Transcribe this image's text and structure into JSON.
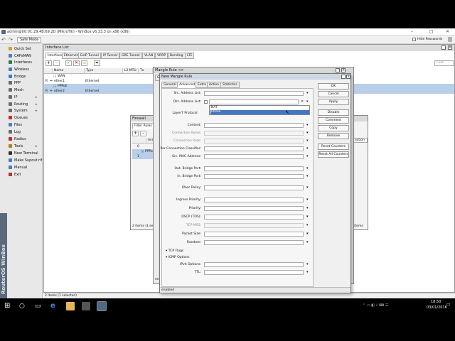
{
  "window": {
    "title": "admin@00:0C:29:4B:69:2D (MikroTik) - WinBox v6.33.3 on x86 (x86)",
    "controls": [
      "–",
      "□",
      "✕"
    ]
  },
  "toolbar": {
    "safe_mode": "Safe Mode",
    "hide_passwords": "Hide Passwords"
  },
  "sidebar": {
    "brand": "RouterOS WinBox",
    "items": [
      {
        "label": "Quick Set",
        "color": "#d9a020"
      },
      {
        "label": "CAPsMAN",
        "color": "#4a7cc0"
      },
      {
        "label": "Interfaces",
        "color": "#2e7d32"
      },
      {
        "label": "Wireless",
        "color": "#4a7cc0"
      },
      {
        "label": "Bridge",
        "color": "#3a7bd5"
      },
      {
        "label": "PPP",
        "color": "#6a6a6a"
      },
      {
        "label": "Mesh",
        "color": "#6a6a6a"
      },
      {
        "label": "IP",
        "color": "#6a6a6a"
      },
      {
        "label": "Routing",
        "color": "#6a6a6a"
      },
      {
        "label": "System",
        "color": "#6a6a6a"
      },
      {
        "label": "Queues",
        "color": "#c62828"
      },
      {
        "label": "Files",
        "color": "#4a7cc0"
      },
      {
        "label": "Log",
        "color": "#6a6a6a"
      },
      {
        "label": "Radius",
        "color": "#c62828"
      },
      {
        "label": "Tools",
        "color": "#b08020"
      },
      {
        "label": "New Terminal",
        "color": "#333333"
      },
      {
        "label": "Make Supout.rif",
        "color": "#4a7cc0"
      },
      {
        "label": "Manual",
        "color": "#4a7cc0"
      },
      {
        "label": "Exit",
        "color": "#c62828"
      }
    ]
  },
  "interface_list": {
    "title": "Interface List",
    "tabs": [
      "Interface",
      "Ethernet",
      "EoIP Tunnel",
      "IP Tunnel",
      "GRE Tunnel",
      "VLAN",
      "VRRP",
      "Bonding",
      "LTE"
    ],
    "find_placeholder": "Find",
    "columns": [
      "Name",
      "Type",
      "L2 MTU",
      "Tx"
    ],
    "rows": [
      {
        "flag": "",
        "name": ";;; WAN",
        "type": ""
      },
      {
        "flag": "R",
        "name": "ether1",
        "type": "Ethernet"
      },
      {
        "flag": "",
        "name": ";;; PPPoE",
        "type": ""
      },
      {
        "flag": "R",
        "name": "ether2",
        "type": "Ethernet"
      }
    ],
    "status": "2 items (1 selected)"
  },
  "firewall": {
    "title": "Firewall",
    "tab": "Filter Rules",
    "col": "Acti",
    "rows": [
      "0",
      ";;; PPPoE",
      "1"
    ],
    "status": "2 items (1 se",
    "status_right": "2 items",
    "dropdown": "action"
  },
  "mangle_rule": {
    "title": "Mangle Rule <>",
    "gen_tab": "Ge",
    "status_left": "ena"
  },
  "new_rule": {
    "title": "New Mangle Rule",
    "tabs": [
      "General",
      "Advanced",
      "Extra",
      "Action",
      "Statistics"
    ],
    "fields": [
      {
        "label": "Src. Address List:",
        "value": ""
      },
      {
        "label": "Dst. Address List:",
        "value": ""
      },
      {
        "label": "Layer7 Protocol:",
        "value": ""
      },
      {
        "label": "Content:",
        "value": ""
      },
      {
        "label": "Connection Bytes:",
        "value": ""
      },
      {
        "label": "Connection Rate:",
        "value": ""
      },
      {
        "label": "Per Connection Classifier:",
        "value": ""
      },
      {
        "label": "Src. MAC Address:",
        "value": ""
      },
      {
        "label": "Out. Bridge Port:",
        "value": ""
      },
      {
        "label": "In. Bridge Port:",
        "value": ""
      },
      {
        "label": "IPsec Policy:",
        "value": ""
      },
      {
        "label": "Ingress Priority:",
        "value": ""
      },
      {
        "label": "Priority:",
        "value": ""
      },
      {
        "label": "DSCP (TOS):",
        "value": ""
      },
      {
        "label": "TCP MSS:",
        "value": ""
      },
      {
        "label": "Packet Size:",
        "value": ""
      },
      {
        "label": "Random:",
        "value": ""
      }
    ],
    "dropdown_options": [
      "NAT",
      "PPPoE"
    ],
    "sections": [
      "TCP Flags",
      "ICMP Options"
    ],
    "icmp_fields": [
      "IPv4 Options:",
      "TTL:"
    ],
    "buttons": [
      "OK",
      "Cancel",
      "Apply",
      "Disable",
      "Comment",
      "Copy",
      "Remove",
      "Reset Counters",
      "Reset All Counters"
    ],
    "status": "enabled"
  },
  "taskbar": {
    "time": "18:50",
    "date": "03/01/2016"
  }
}
